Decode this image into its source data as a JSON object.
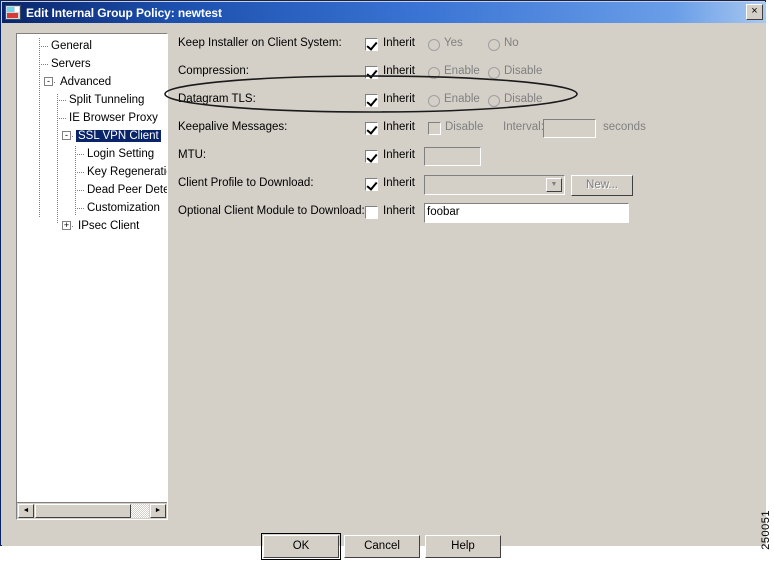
{
  "window": {
    "title": "Edit Internal Group Policy: newtest",
    "icon": "app-icon",
    "close_label": "×"
  },
  "tree": {
    "items": [
      {
        "label": "General",
        "indent": 0,
        "toggle": "",
        "selected": false
      },
      {
        "label": "Servers",
        "indent": 0,
        "toggle": "",
        "selected": false
      },
      {
        "label": "Advanced",
        "indent": 0,
        "toggle": "-",
        "selected": false
      },
      {
        "label": "Split Tunneling",
        "indent": 1,
        "toggle": "",
        "selected": false
      },
      {
        "label": "IE Browser Proxy",
        "indent": 1,
        "toggle": "",
        "selected": false
      },
      {
        "label": "SSL VPN Client",
        "indent": 1,
        "toggle": "-",
        "selected": true
      },
      {
        "label": "Login Setting",
        "indent": 2,
        "toggle": "",
        "selected": false
      },
      {
        "label": "Key Regeneration",
        "indent": 2,
        "toggle": "",
        "selected": false
      },
      {
        "label": "Dead Peer Detecti",
        "indent": 2,
        "toggle": "",
        "selected": false
      },
      {
        "label": "Customization",
        "indent": 2,
        "toggle": "",
        "selected": false
      },
      {
        "label": "IPsec Client",
        "indent": 1,
        "toggle": "+",
        "selected": false
      }
    ],
    "scroll_left_arrow": "◄",
    "scroll_right_arrow": "►"
  },
  "form": {
    "inherit_label": "Inherit",
    "rows": [
      {
        "label": "Keep Installer on Client System:",
        "inherit_checked": true,
        "option1": "Yes",
        "option2": "No"
      },
      {
        "label": "Compression:",
        "inherit_checked": true,
        "option1": "Enable",
        "option2": "Disable"
      },
      {
        "label": "Datagram TLS:",
        "inherit_checked": true,
        "option1": "Enable",
        "option2": "Disable"
      }
    ],
    "keepalive": {
      "label": "Keepalive Messages:",
      "inherit_checked": true,
      "disable_label": "Disable",
      "disable_checked": false,
      "interval_label": "Interval:",
      "interval_value": "",
      "seconds_label": "seconds"
    },
    "mtu": {
      "label": "MTU:",
      "inherit_checked": true,
      "value": ""
    },
    "client_profile": {
      "label": "Client Profile to Download:",
      "inherit_checked": true,
      "selected_value": "",
      "new_button": "New...",
      "dropdown_arrow": "▼"
    },
    "optional_module": {
      "label": "Optional Client Module to Download:",
      "inherit_checked": false,
      "value": "foobar"
    }
  },
  "buttons": {
    "ok": "OK",
    "cancel": "Cancel",
    "help": "Help"
  },
  "watermark": "250051",
  "colors": {
    "dialog_face": "#d4d0c8",
    "title_start": "#0a246a",
    "title_end": "#a8c8f0",
    "selection": "#0a246a",
    "disabled_text": "#808080"
  }
}
